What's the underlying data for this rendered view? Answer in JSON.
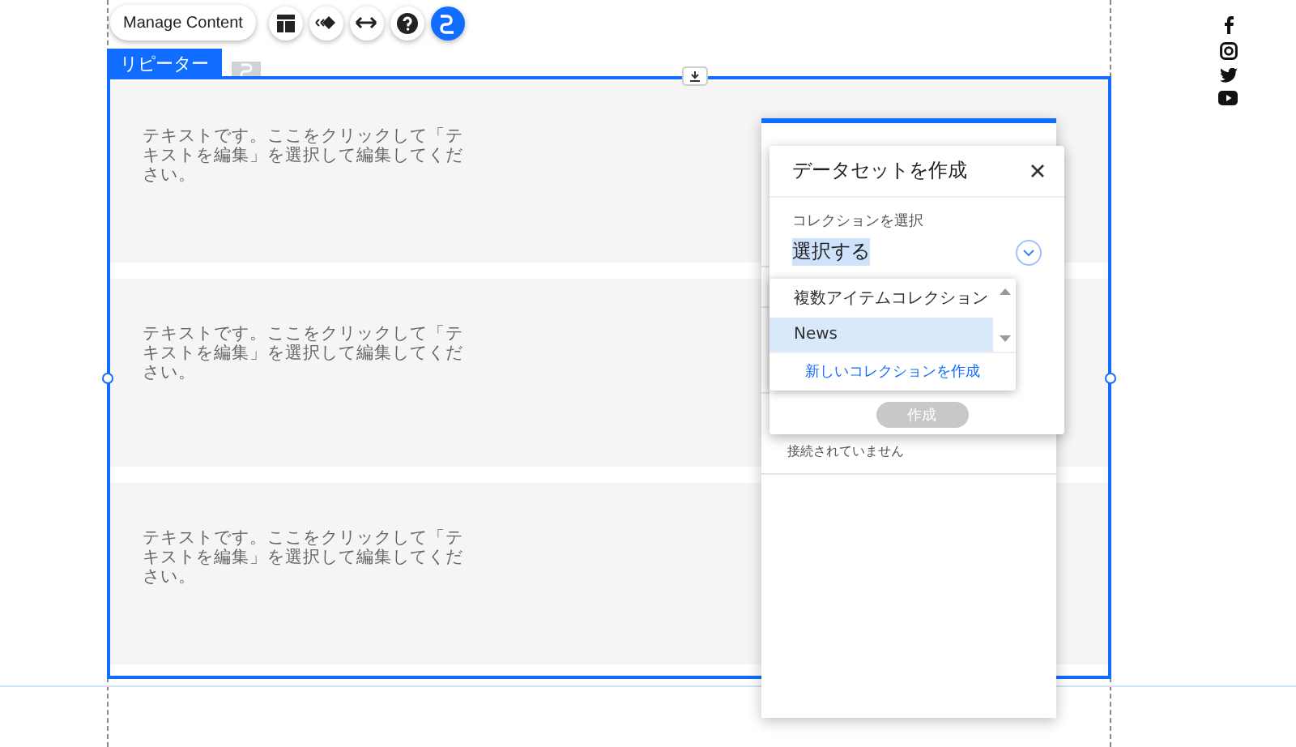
{
  "toolbar": {
    "manage_button": "Manage Content",
    "icons": [
      {
        "kind": "layout",
        "selected": false
      },
      {
        "kind": "animation",
        "selected": false
      },
      {
        "kind": "stretch",
        "selected": false
      },
      {
        "kind": "help",
        "selected": false
      },
      {
        "kind": "connect",
        "selected": true
      }
    ]
  },
  "repeater": {
    "tab": "リピーター",
    "items": [
      {
        "text": "テキストです。ここをクリックして「テキストを編集」を選択して編集してください。"
      },
      {
        "text": "テキストです。ここをクリックして「テキストを編集」を選択して編集してください。"
      },
      {
        "text": "テキストです。ここをクリックして「テキストを編集」を選択して編集してください。"
      }
    ]
  },
  "connect_panel": {
    "status": "接続されていません"
  },
  "dialog": {
    "title": "データセットを作成",
    "field_label": "コレクションを選択",
    "value": "選択する",
    "options": [
      {
        "label": "複数アイテムコレクション",
        "selected": false
      },
      {
        "label": "News",
        "selected": true
      }
    ],
    "create_link": "新しいコレクションを作成",
    "create_button": {
      "label": "作成",
      "disabled": true
    }
  },
  "social": [
    {
      "kind": "facebook"
    },
    {
      "kind": "instagram"
    },
    {
      "kind": "twitter"
    },
    {
      "kind": "youtube"
    }
  ]
}
